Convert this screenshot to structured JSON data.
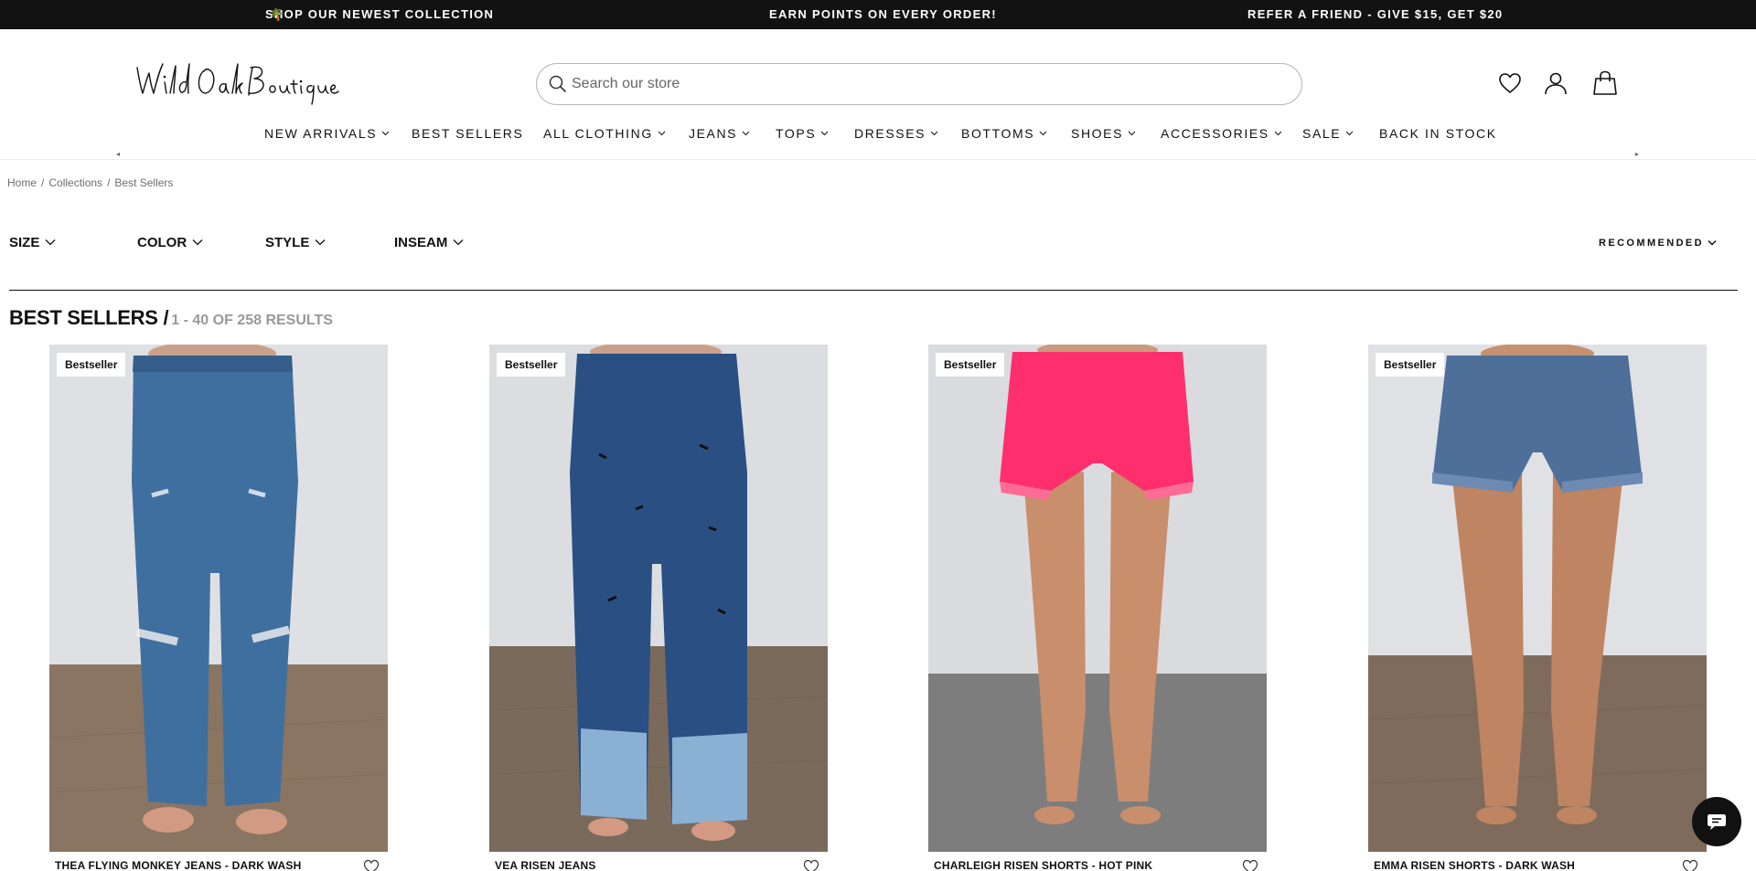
{
  "announcements": [
    "SHOP OUR NEWEST COLLECTION",
    "EARN POINTS ON EVERY ORDER!",
    "REFER A FRIEND - GIVE $15, GET $20"
  ],
  "logo_text": "Wild Oak Boutique",
  "search": {
    "placeholder": "Search our store"
  },
  "header_icons": [
    "heart-icon",
    "account-icon",
    "shopping-bag-icon"
  ],
  "nav": [
    {
      "label": "NEW ARRIVALS",
      "dropdown": true
    },
    {
      "label": "BEST SELLERS",
      "dropdown": false
    },
    {
      "label": "ALL CLOTHING",
      "dropdown": true
    },
    {
      "label": "JEANS",
      "dropdown": true
    },
    {
      "label": "TOPS",
      "dropdown": true
    },
    {
      "label": "DRESSES",
      "dropdown": true
    },
    {
      "label": "BOTTOMS",
      "dropdown": true
    },
    {
      "label": "SHOES",
      "dropdown": true
    },
    {
      "label": "ACCESSORIES",
      "dropdown": true
    },
    {
      "label": "SALE",
      "dropdown": true
    },
    {
      "label": "BACK IN STOCK",
      "dropdown": false
    }
  ],
  "breadcrumb": [
    "Home",
    "Collections",
    "Best Sellers"
  ],
  "filters": [
    "SIZE",
    "COLOR",
    "STYLE",
    "INSEAM"
  ],
  "sort": {
    "selected": "RECOMMENDED"
  },
  "listing": {
    "title": "BEST SELLERS /",
    "count_text": "1 - 40 OF 258 RESULTS"
  },
  "products": [
    {
      "badge": "Bestseller",
      "name": "THEA FLYING MONKEY JEANS - DARK WASH",
      "color": "#3f6f9f"
    },
    {
      "badge": "Bestseller",
      "name": "VEA RISEN JEANS",
      "color": "#2a4f82"
    },
    {
      "badge": "Bestseller",
      "name": "CHARLEIGH RISEN SHORTS - HOT PINK",
      "color": "#ff2f6d"
    },
    {
      "badge": "Bestseller",
      "name": "EMMA RISEN SHORTS - DARK WASH",
      "color": "#4d6f9a"
    }
  ],
  "colors": {
    "announcement_bg": "#121212",
    "accent": "#111111",
    "muted": "#999999"
  }
}
